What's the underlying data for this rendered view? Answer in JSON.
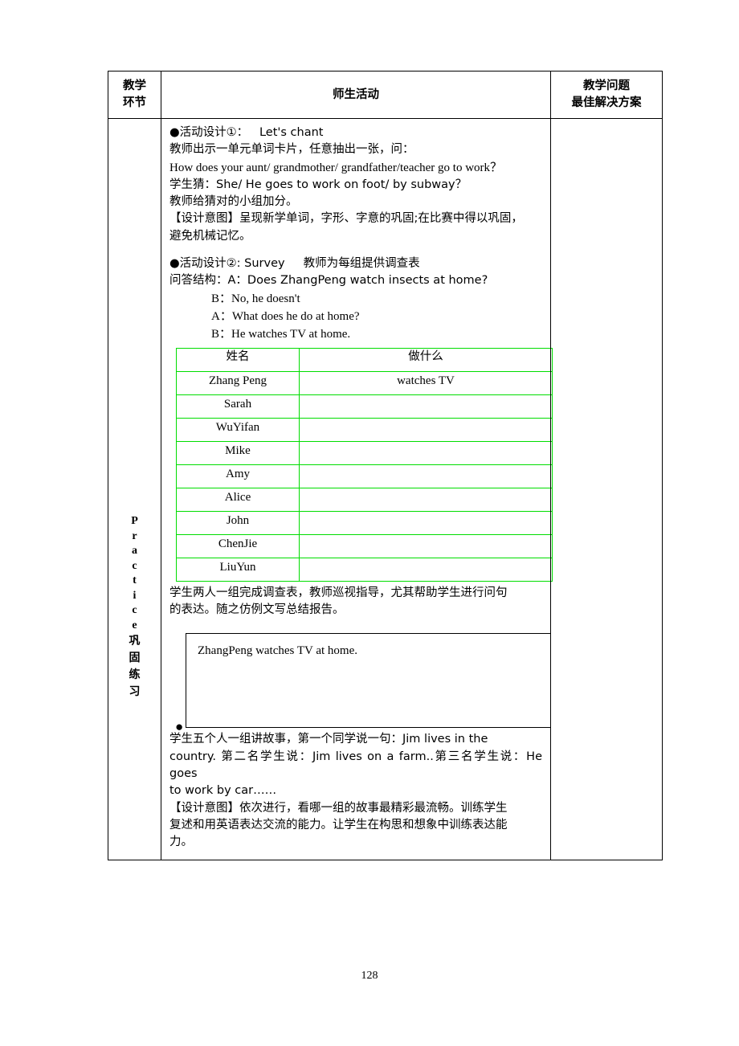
{
  "header": {
    "col1_line1": "教学",
    "col1_line2": "环节",
    "col2": "师生活动",
    "col3_line1": "教学问题",
    "col3_line2": "最佳解决方案"
  },
  "stage": {
    "letters": [
      "P",
      "r",
      "a",
      "c",
      "t",
      "i",
      "c",
      "e"
    ],
    "cn_lines": [
      "巩",
      "固",
      "练",
      "习"
    ]
  },
  "body": {
    "activity1_title": "●活动设计①：   Let's chant",
    "activity1_l1": "教师出示一单元单词卡片，任意抽出一张，问：",
    "activity1_l2": "How does your aunt/ grandmother/ grandfather/teacher go to work？",
    "activity1_l3": "学生猜：She/ He goes to work on foot/ by subway？",
    "activity1_l4": "教师给猜对的小组加分。",
    "activity1_l5": "【设计意图】呈现新学单词，字形、字意的巩固;在比赛中得以巩固，",
    "activity1_l6": "避免机械记忆。",
    "activity2_title": "●活动设计②: Survey     教师为每组提供调查表",
    "activity2_l1": "问答结构：A：Does ZhangPeng watch insects at home?",
    "activity2_l2": "B：No, he doesn't",
    "activity2_l3": "A：What does he do at home?",
    "activity2_l4": "B：He watches TV at home.",
    "after_table_l1": "学生两人一组完成调查表，教师巡视指导，尤其帮助学生进行问句",
    "after_table_l2": "的表达。随之仿例文写总结报告。",
    "storybox_text": "ZhangPeng watches TV at home.",
    "story_l1": "学生五个人一组讲故事，第一个同学说一句：Jim lives in the",
    "story_l2": "country. 第二名学生说：Jim lives on a farm..第三名学生说：He goes",
    "story_l3": "to work by car……",
    "story_l4": "【设计意图】依次进行，看哪一组的故事最精彩最流畅。训练学生",
    "story_l5": "复述和用英语表达交流的能力。让学生在构思和想象中训练表达能",
    "story_l6": "力。"
  },
  "survey_table": {
    "headers": [
      "姓名",
      "做什么"
    ],
    "rows": [
      {
        "name": "Zhang Peng",
        "action": "watches TV"
      },
      {
        "name": "Sarah",
        "action": ""
      },
      {
        "name": "WuYifan",
        "action": ""
      },
      {
        "name": "Mike",
        "action": ""
      },
      {
        "name": "Amy",
        "action": ""
      },
      {
        "name": "Alice",
        "action": ""
      },
      {
        "name": "John",
        "action": ""
      },
      {
        "name": "ChenJie",
        "action": ""
      },
      {
        "name": "LiuYun",
        "action": ""
      }
    ]
  },
  "page_number": "128"
}
